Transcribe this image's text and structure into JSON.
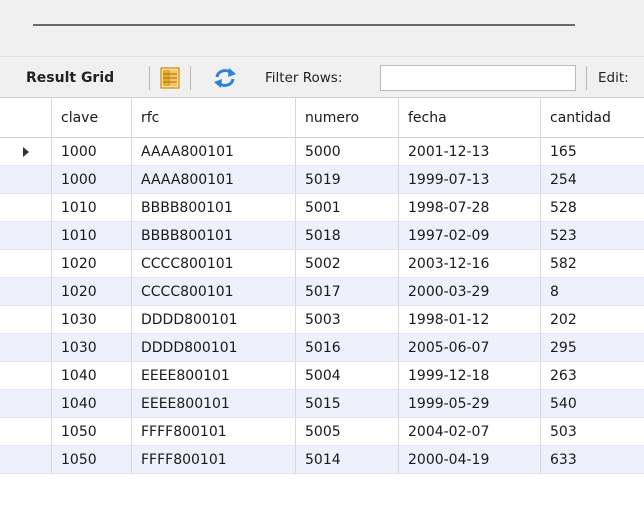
{
  "toolbar": {
    "result_grid_label": "Result Grid",
    "filter_label": "Filter Rows:",
    "filter_value": "",
    "edit_label": "Edit:"
  },
  "grid": {
    "columns": [
      "clave",
      "rfc",
      "numero",
      "fecha",
      "cantidad"
    ],
    "rows": [
      [
        "1000",
        "AAAA800101",
        "5000",
        "2001-12-13",
        "165"
      ],
      [
        "1000",
        "AAAA800101",
        "5019",
        "1999-07-13",
        "254"
      ],
      [
        "1010",
        "BBBB800101",
        "5001",
        "1998-07-28",
        "528"
      ],
      [
        "1010",
        "BBBB800101",
        "5018",
        "1997-02-09",
        "523"
      ],
      [
        "1020",
        "CCCC800101",
        "5002",
        "2003-12-16",
        "582"
      ],
      [
        "1020",
        "CCCC800101",
        "5017",
        "2000-03-29",
        "8"
      ],
      [
        "1030",
        "DDDD800101",
        "5003",
        "1998-01-12",
        "202"
      ],
      [
        "1030",
        "DDDD800101",
        "5016",
        "2005-06-07",
        "295"
      ],
      [
        "1040",
        "EEEE800101",
        "5004",
        "1999-12-18",
        "263"
      ],
      [
        "1040",
        "EEEE800101",
        "5015",
        "1999-05-29",
        "540"
      ],
      [
        "1050",
        "FFFF800101",
        "5005",
        "2004-02-07",
        "503"
      ],
      [
        "1050",
        "FFFF800101",
        "5014",
        "2000-04-19",
        "633"
      ]
    ],
    "selected_row": 0
  },
  "colors": {
    "alt_row": "#edf1fb",
    "toolbar_bg": "#f0f0f0",
    "refresh_icon": "#2b82d9",
    "grid_icon": "#f0a928"
  },
  "icons": {
    "grid_icon": "result-grid-icon",
    "refresh_icon": "refresh-icon",
    "row_marker": "row-pointer-icon"
  }
}
